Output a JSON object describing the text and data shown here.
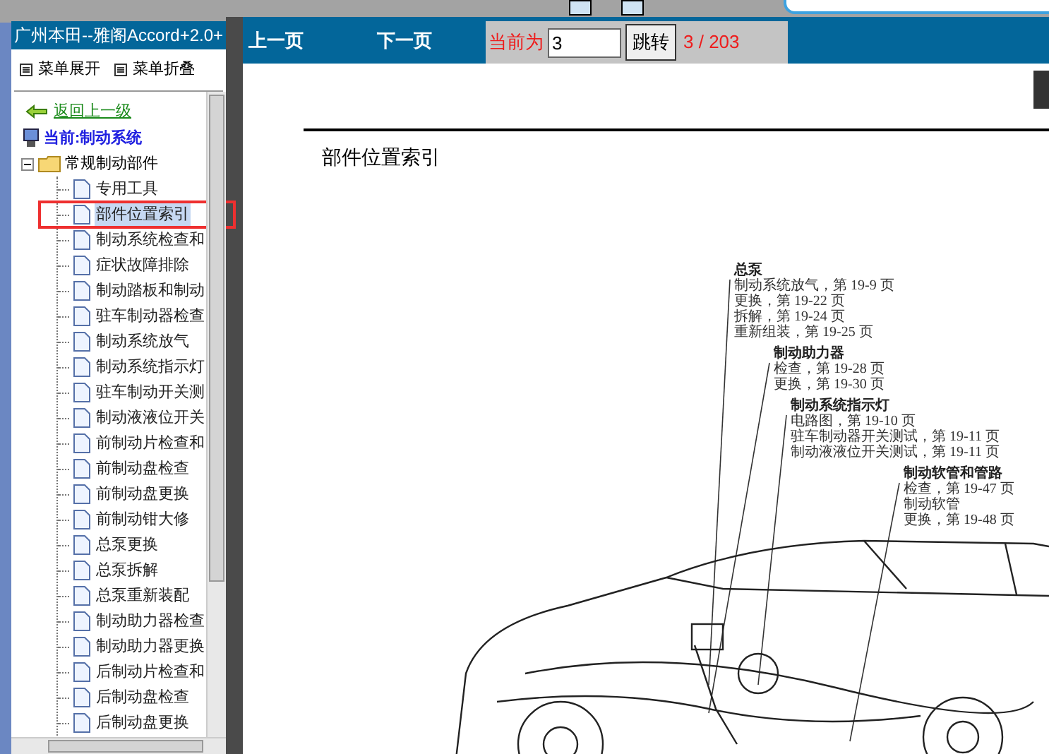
{
  "left_panel": {
    "title": "广州本田--雅阁Accord+2.0+",
    "menu": [
      {
        "label": "菜单展开"
      },
      {
        "label": "菜单折叠"
      }
    ],
    "back_link": "返回上一级",
    "current": "当前:制动系统",
    "tree": [
      {
        "label": "常规制动部件",
        "expanded": true,
        "children": [
          {
            "label": "专用工具",
            "selected": false
          },
          {
            "label": "部件位置索引",
            "selected": true
          },
          {
            "label": "制动系统检查和",
            "selected": false
          },
          {
            "label": "症状故障排除",
            "selected": false
          },
          {
            "label": "制动踏板和制动",
            "selected": false
          },
          {
            "label": "驻车制动器检查",
            "selected": false
          },
          {
            "label": "制动系统放气",
            "selected": false
          },
          {
            "label": "制动系统指示灯",
            "selected": false
          },
          {
            "label": "驻车制动开关测",
            "selected": false
          },
          {
            "label": "制动液液位开关",
            "selected": false
          },
          {
            "label": "前制动片检查和",
            "selected": false
          },
          {
            "label": "前制动盘检查",
            "selected": false
          },
          {
            "label": "前制动盘更换",
            "selected": false
          },
          {
            "label": "前制动钳大修",
            "selected": false
          },
          {
            "label": "总泵更换",
            "selected": false
          },
          {
            "label": "总泵拆解",
            "selected": false
          },
          {
            "label": "总泵重新装配",
            "selected": false
          },
          {
            "label": "制动助力器检查",
            "selected": false
          },
          {
            "label": "制动助力器更换",
            "selected": false
          },
          {
            "label": "后制动片检查和",
            "selected": false
          },
          {
            "label": "后制动盘检查",
            "selected": false
          },
          {
            "label": "后制动盘更换",
            "selected": false
          }
        ]
      }
    ]
  },
  "toolbar": {
    "prev": "上一页",
    "next": "下一页",
    "current_label": "当前为",
    "page_input": "3",
    "jump_button": "跳转",
    "page_count": "3 / 203"
  },
  "document": {
    "heading": "部件位置索引",
    "callouts": [
      {
        "title": "总泵",
        "lines": [
          "制动系统放气，第 19-9 页",
          "更换，第 19-22 页",
          "拆解，第 19-24 页",
          "重新组装，第 19-25 页"
        ]
      },
      {
        "title": "制动助力器",
        "lines": [
          "检查，第 19-28 页",
          "更换，第 19-30 页"
        ]
      },
      {
        "title": "制动系统指示灯",
        "lines": [
          "电路图，第 19-10 页",
          "驻车制动器开关测试，第 19-11 页",
          "制动液液位开关测试，第 19-11 页"
        ]
      },
      {
        "title": "制动软管和管路",
        "lines": [
          "检查，第 19-47 页",
          "制动软管",
          "更换，第 19-48 页"
        ]
      }
    ]
  }
}
